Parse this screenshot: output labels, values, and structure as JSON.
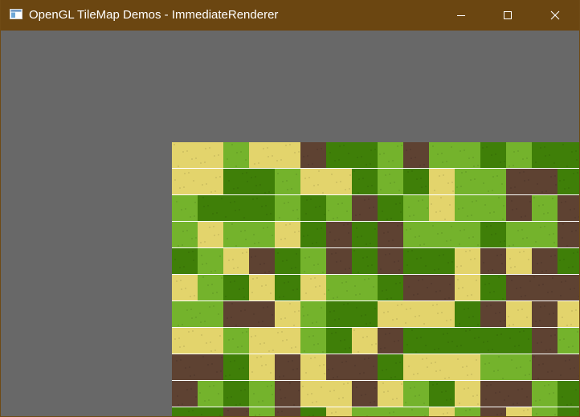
{
  "window": {
    "title": "OpenGL TileMap Demos - ImmediateRenderer",
    "icon": "app-window-icon",
    "controls": {
      "minimize_icon": "minimize-icon",
      "maximize_icon": "maximize-icon",
      "close_icon": "close-icon"
    },
    "colors": {
      "titlebar": "#6b4611",
      "title_text": "#ffffff",
      "clear_color": "#686868",
      "row_separator": "#ffffff"
    }
  },
  "tilemap": {
    "tile_types": {
      "S": {
        "name": "sand",
        "color": "#e3d46c"
      },
      "L": {
        "name": "light-grass",
        "color": "#74b32c"
      },
      "G": {
        "name": "dark-grass",
        "color": "#3f7f08"
      },
      "D": {
        "name": "dirt",
        "color": "#5e4232"
      }
    },
    "rows": [
      "SSLSSDGGLDLLGLGG",
      "SSGGLSSGLGSLLDDG",
      "LGGGLGLDGLSLLDLD",
      "LSLLSGDGDLLLGLLD",
      "GLSDGLDGDGGSDSDG",
      "SLGSGSLLGDDSGDDD",
      "LLDDSLGGSSSGDSDS",
      "SSLSSLGSDGGGGGDL",
      "DDGSDSDDGSSSLLDD",
      "DLGLDSSDSLGSDDLG",
      "GGDLDGSLLLSLDSLG"
    ]
  }
}
